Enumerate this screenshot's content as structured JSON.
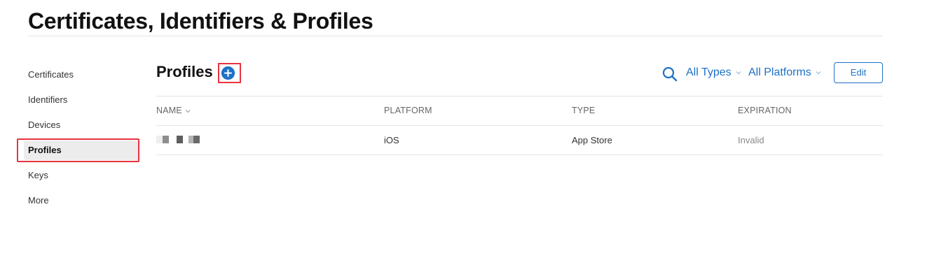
{
  "page": {
    "title": "Certificates, Identifiers & Profiles"
  },
  "sidebar": {
    "items": [
      {
        "label": "Certificates",
        "active": false
      },
      {
        "label": "Identifiers",
        "active": false
      },
      {
        "label": "Devices",
        "active": false
      },
      {
        "label": "Profiles",
        "active": true
      },
      {
        "label": "Keys",
        "active": false
      },
      {
        "label": "More",
        "active": false
      }
    ]
  },
  "main": {
    "section_title": "Profiles",
    "add_icon": "plus-circle-icon",
    "search_icon": "search-icon",
    "filters": {
      "type": "All Types",
      "platform": "All Platforms"
    },
    "edit_label": "Edit",
    "table": {
      "columns": [
        "NAME",
        "PLATFORM",
        "TYPE",
        "EXPIRATION"
      ],
      "rows": [
        {
          "name": "",
          "platform": "iOS",
          "type": "App Store",
          "expiration": "Invalid"
        }
      ]
    }
  },
  "colors": {
    "accent": "#1d71c7",
    "highlight": "#e8333f"
  }
}
